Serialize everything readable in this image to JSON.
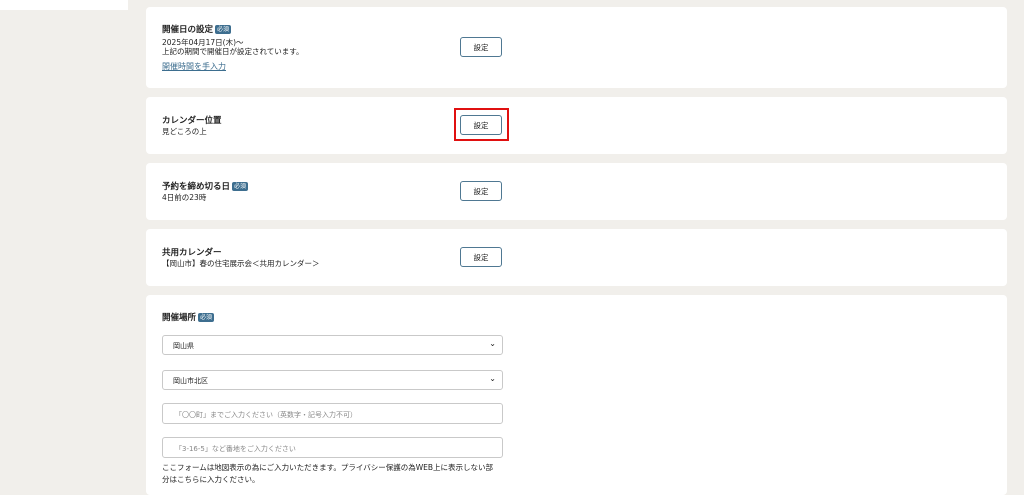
{
  "settings": {
    "date_card": {
      "title": "開催日の設定",
      "badge": "必須",
      "line1": "2025年04月17日(木)〜",
      "line2": "上記の期間で開催日が設定されています。",
      "link": "開催時間を手入力",
      "button": "設定"
    },
    "calendar_position": {
      "title": "カレンダー位置",
      "value": "見どころの上",
      "button": "設定"
    },
    "deadline": {
      "title": "予約を締め切る日",
      "badge": "必須",
      "value": "4日前の23時",
      "button": "設定"
    },
    "shared_calendar": {
      "title": "共用カレンダー",
      "value": "【岡山市】春の住宅展示会＜共用カレンダー＞",
      "button": "設定"
    },
    "venue": {
      "title": "開催場所",
      "badge": "必須",
      "prefecture": "岡山県",
      "city": "岡山市北区",
      "town_placeholder": "「〇〇町」までご入力ください（英数字・記号入力不可）",
      "address_placeholder": "「3-16-5」など番地をご入力ください",
      "note_line1": "ここフォームは地図表示の為にご入力いただきます。プライバシー保護の為WEB上に表示しない部",
      "note_line2": "分はこちらに入力ください。"
    }
  },
  "icons": {
    "select_chevron": "chevron-down-icon"
  },
  "colors": {
    "page_bg": "#f1efeb",
    "accent": "#3d6e8f",
    "highlight": "#e01010"
  }
}
